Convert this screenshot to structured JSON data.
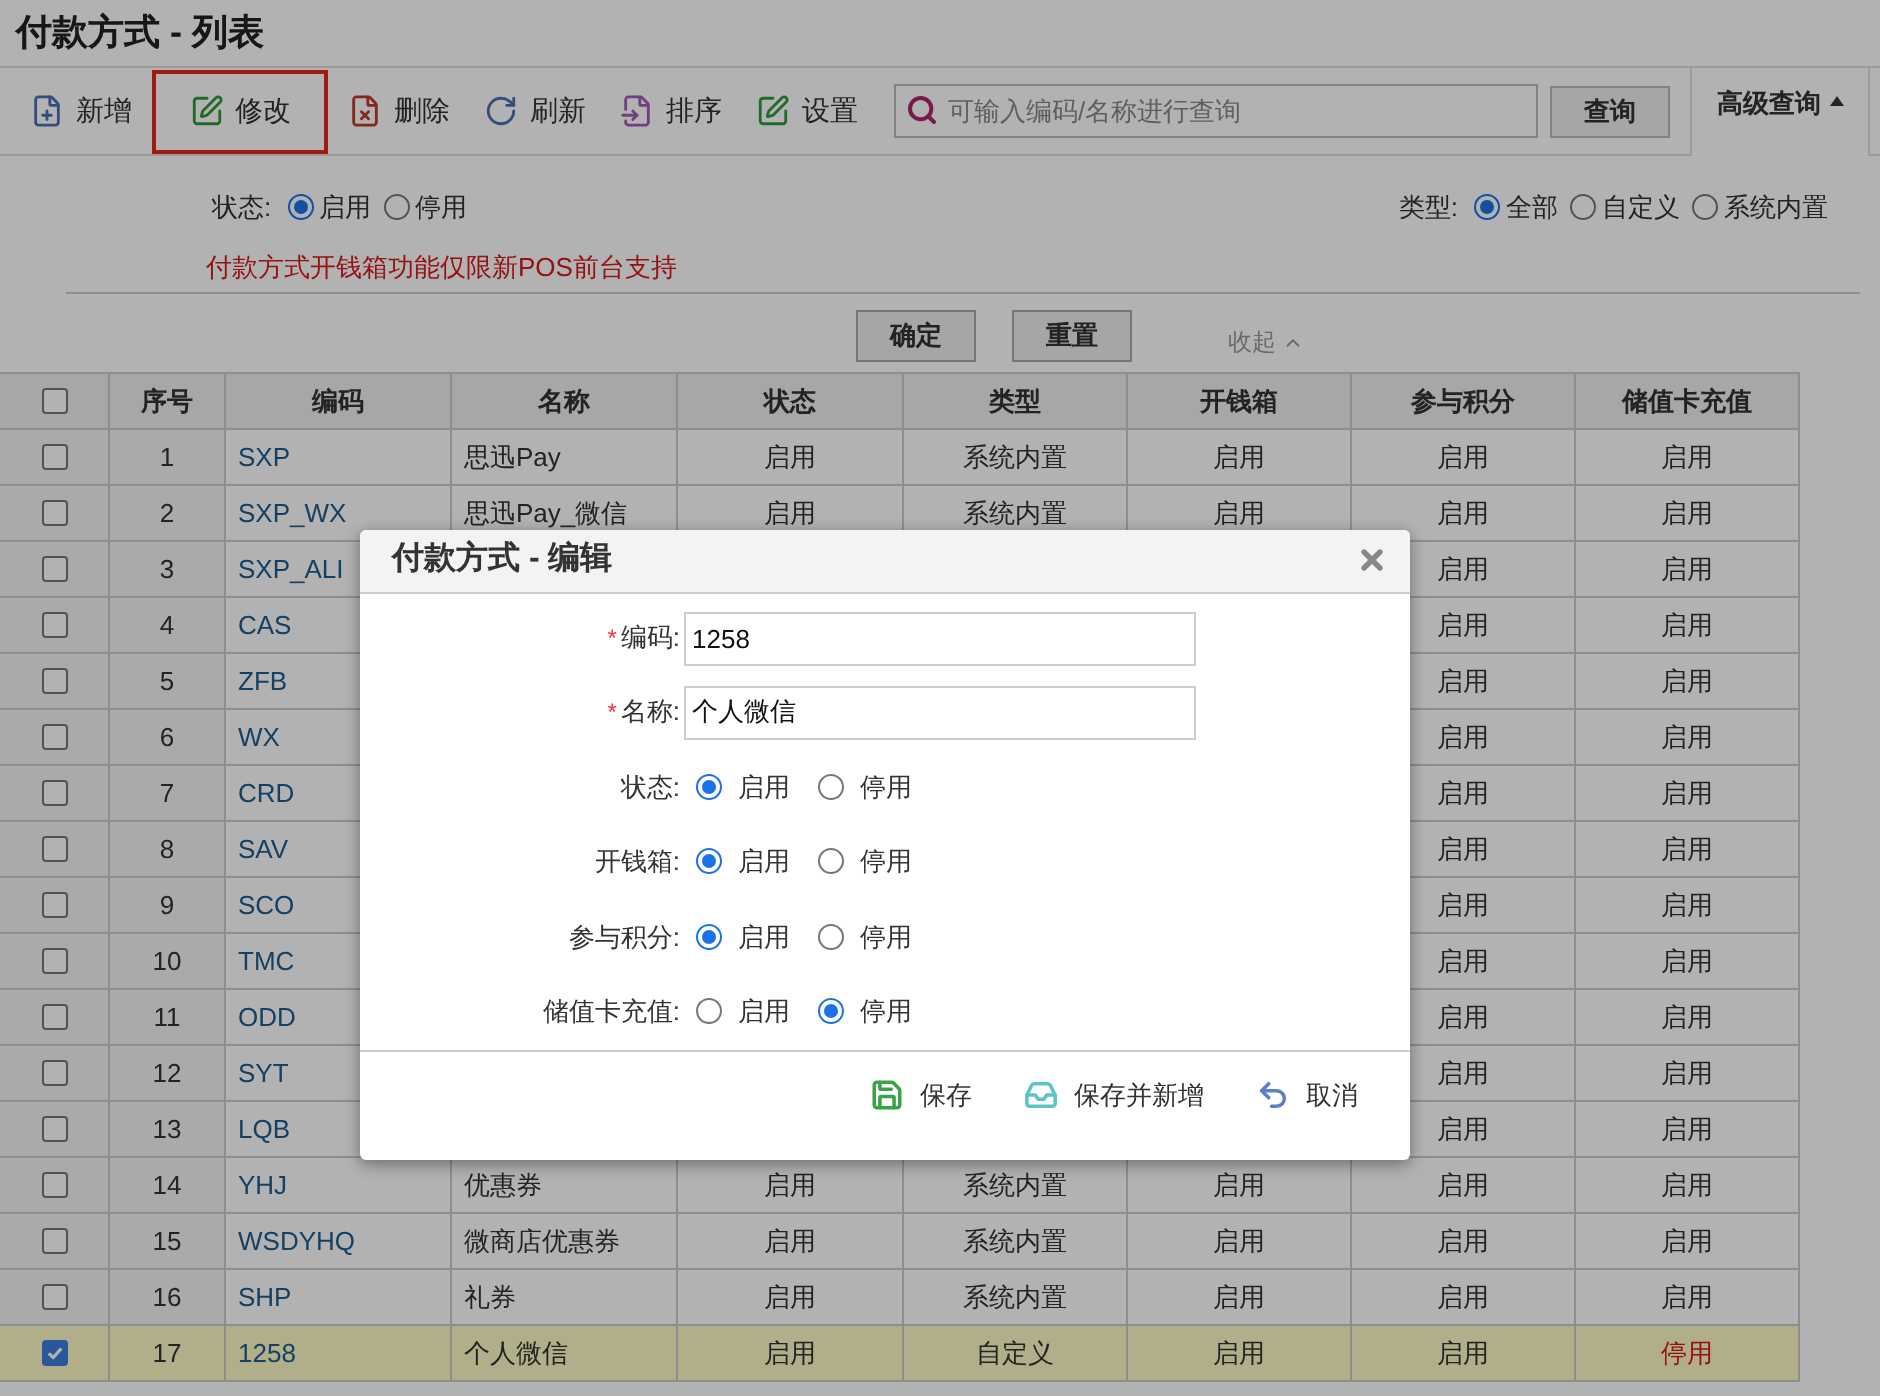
{
  "page_title": "付款方式 - 列表",
  "toolbar": [
    {
      "label": "新增",
      "highlighted": false
    },
    {
      "label": "修改",
      "highlighted": true
    },
    {
      "label": "删除",
      "highlighted": false
    },
    {
      "label": "刷新",
      "highlighted": false
    },
    {
      "label": "排序",
      "highlighted": false
    },
    {
      "label": "设置",
      "highlighted": false
    }
  ],
  "search": {
    "placeholder": "可输入编码/名称进行查询",
    "button": "查询"
  },
  "advanced_toggle": {
    "label": "高级查询",
    "expanded": true
  },
  "filters": [
    {
      "label": "状态:",
      "options": [
        {
          "label": "启用",
          "selected": true
        },
        {
          "label": "停用",
          "selected": false
        }
      ]
    },
    {
      "label": "类型:",
      "options": [
        {
          "label": "全部",
          "selected": true
        },
        {
          "label": "自定义",
          "selected": false
        },
        {
          "label": "系统内置",
          "selected": false
        }
      ]
    }
  ],
  "notice": "付款方式开钱箱功能仅限新POS前台支持",
  "filter_buttons": [
    "确定",
    "重置"
  ],
  "collapse_link": "收起",
  "table": {
    "select_all_checked": false,
    "columns": [
      "序号",
      "编码",
      "名称",
      "状态",
      "类型",
      "开钱箱",
      "参与积分",
      "储值卡充值"
    ],
    "rows": [
      {
        "selected": false,
        "no": "1",
        "code": "SXP",
        "name": "思迅Pay",
        "status": "启用",
        "type": "系统内置",
        "cashbox": "启用",
        "points": "启用",
        "recharge": "启用",
        "recharge_off": false
      },
      {
        "selected": false,
        "no": "2",
        "code": "SXP_WX",
        "name": "思迅Pay_微信",
        "status": "启用",
        "type": "系统内置",
        "cashbox": "启用",
        "points": "启用",
        "recharge": "启用",
        "recharge_off": false
      },
      {
        "selected": false,
        "no": "3",
        "code": "SXP_ALI",
        "points": "启用",
        "recharge": "启用",
        "recharge_off": false
      },
      {
        "selected": false,
        "no": "4",
        "code": "CAS",
        "points": "启用",
        "recharge": "启用",
        "recharge_off": false
      },
      {
        "selected": false,
        "no": "5",
        "code": "ZFB",
        "points": "启用",
        "recharge": "启用",
        "recharge_off": false
      },
      {
        "selected": false,
        "no": "6",
        "code": "WX",
        "points": "启用",
        "recharge": "启用",
        "recharge_off": false
      },
      {
        "selected": false,
        "no": "7",
        "code": "CRD",
        "points": "启用",
        "recharge": "启用",
        "recharge_off": false
      },
      {
        "selected": false,
        "no": "8",
        "code": "SAV",
        "points": "启用",
        "recharge": "启用",
        "recharge_off": false
      },
      {
        "selected": false,
        "no": "9",
        "code": "SCO",
        "points": "启用",
        "recharge": "启用",
        "recharge_off": false
      },
      {
        "selected": false,
        "no": "10",
        "code": "TMC",
        "points": "启用",
        "recharge": "启用",
        "recharge_off": false
      },
      {
        "selected": false,
        "no": "11",
        "code": "ODD",
        "points": "启用",
        "recharge": "启用",
        "recharge_off": false
      },
      {
        "selected": false,
        "no": "12",
        "code": "SYT",
        "points": "启用",
        "recharge": "启用",
        "recharge_off": false
      },
      {
        "selected": false,
        "no": "13",
        "code": "LQB",
        "points": "启用",
        "recharge": "启用",
        "recharge_off": false
      },
      {
        "selected": false,
        "no": "14",
        "code": "YHJ",
        "name": "优惠券",
        "status": "启用",
        "type": "系统内置",
        "cashbox": "启用",
        "points": "启用",
        "recharge": "启用",
        "recharge_off": false
      },
      {
        "selected": false,
        "no": "15",
        "code": "WSDYHQ",
        "name": "微商店优惠券",
        "status": "启用",
        "type": "系统内置",
        "cashbox": "启用",
        "points": "启用",
        "recharge": "启用",
        "recharge_off": false
      },
      {
        "selected": false,
        "no": "16",
        "code": "SHP",
        "name": "礼券",
        "status": "启用",
        "type": "系统内置",
        "cashbox": "启用",
        "points": "启用",
        "recharge": "启用",
        "recharge_off": false
      },
      {
        "selected": true,
        "no": "17",
        "code": "1258",
        "name": "个人微信",
        "status": "启用",
        "type": "自定义",
        "cashbox": "启用",
        "points": "启用",
        "recharge": "停用",
        "recharge_off": true
      }
    ]
  },
  "dialog": {
    "title": "付款方式 - 编辑",
    "fields": [
      {
        "kind": "text",
        "label": "编码:",
        "required_mark": "*",
        "value": "1258"
      },
      {
        "kind": "text",
        "label": "名称:",
        "required_mark": "*",
        "value": "个人微信"
      },
      {
        "kind": "radio",
        "label": "状态:",
        "options": [
          {
            "label": "启用",
            "selected": true
          },
          {
            "label": "停用",
            "selected": false
          }
        ]
      },
      {
        "kind": "radio",
        "label": "开钱箱:",
        "options": [
          {
            "label": "启用",
            "selected": true
          },
          {
            "label": "停用",
            "selected": false
          }
        ]
      },
      {
        "kind": "radio",
        "label": "参与积分:",
        "options": [
          {
            "label": "启用",
            "selected": true
          },
          {
            "label": "停用",
            "selected": false
          }
        ]
      },
      {
        "kind": "radio",
        "label": "储值卡充值:",
        "options": [
          {
            "label": "启用",
            "selected": false
          },
          {
            "label": "停用",
            "selected": true
          }
        ]
      }
    ],
    "buttons": [
      {
        "label": "保存"
      },
      {
        "label": "保存并新增"
      },
      {
        "label": "取消"
      }
    ]
  }
}
